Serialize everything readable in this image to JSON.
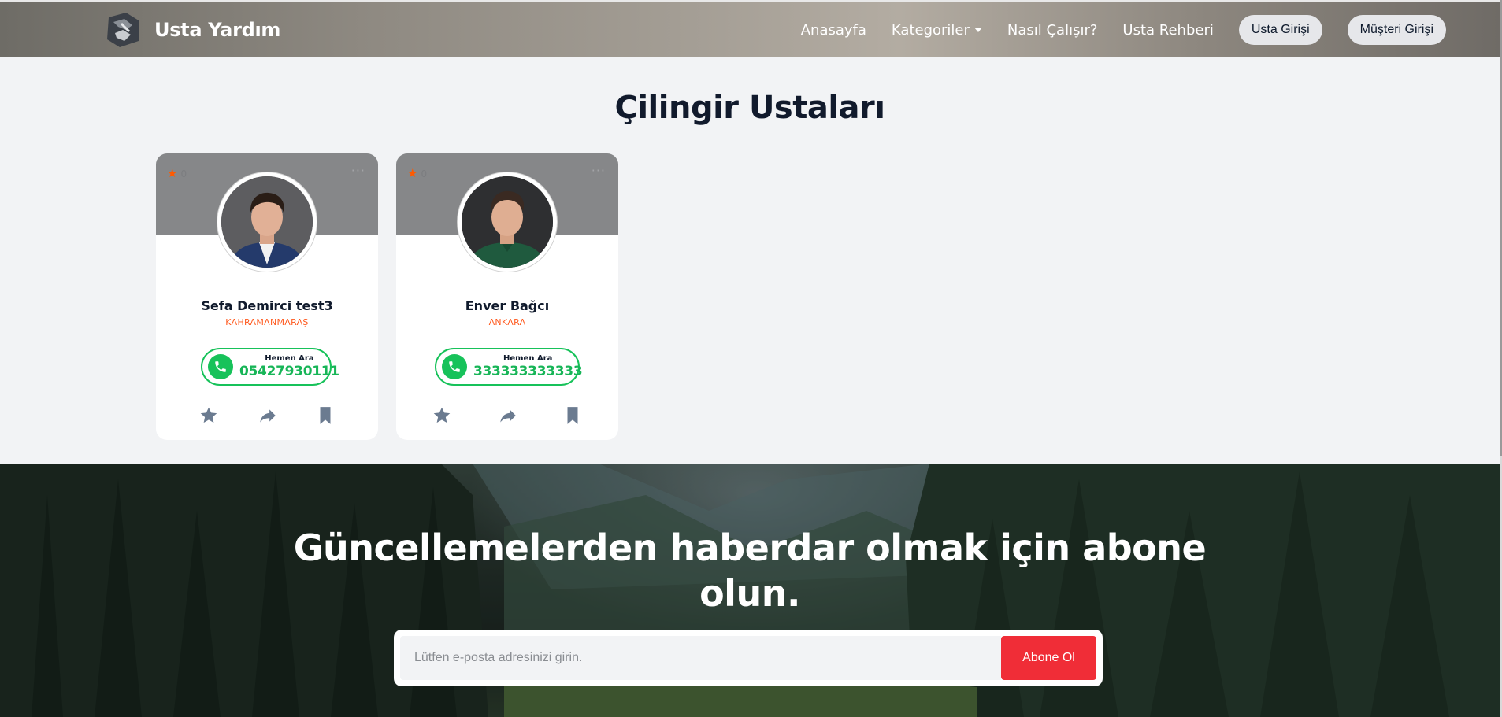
{
  "brand": {
    "name": "Usta Yardım"
  },
  "nav": {
    "links": [
      "Anasayfa",
      "Kategoriler",
      "Nasıl Çalışır?",
      "Usta Rehberi"
    ],
    "usta_login": "Usta Girişi",
    "musteri_login": "Müşteri Girişi"
  },
  "page": {
    "title": "Çilingir Ustaları"
  },
  "cards": [
    {
      "rating": "0",
      "name": "Sefa Demirci test3",
      "city": "KAHRAMANMARAŞ",
      "call_label": "Hemen Ara",
      "phone": "05427930111"
    },
    {
      "rating": "0",
      "name": "Enver Bağcı",
      "city": "ANKARA",
      "call_label": "Hemen Ara",
      "phone": "333333333333"
    }
  ],
  "subscribe": {
    "title": "Güncellemelerden haberdar olmak için abone olun.",
    "placeholder": "Lütfen e-posta adresinizi girin.",
    "button": "Abone Ol"
  },
  "colors": {
    "accent_orange": "#ff5a1f",
    "call_green": "#17c25a",
    "subscribe_red": "#f02d37",
    "title_navy": "#111a2c"
  },
  "icons": {
    "brand": "wrench-handshake-logo",
    "rating": "star-icon",
    "more": "ellipsis-icon",
    "call": "phone-icon",
    "actions": [
      "star-icon",
      "share-icon",
      "bookmark-icon"
    ]
  }
}
